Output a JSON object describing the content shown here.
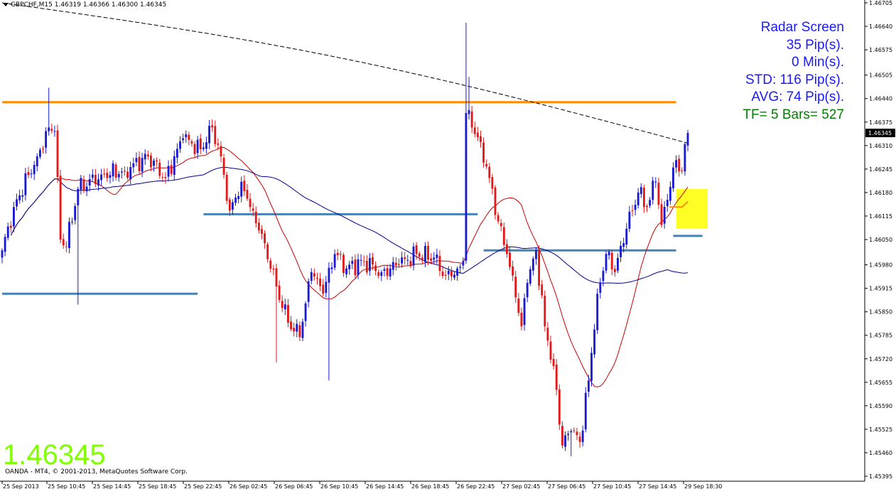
{
  "header": {
    "symbol_info": "GBPCHF,M15  1.46319 1.46366 1.46300 1.46345"
  },
  "radar": {
    "lines": [
      {
        "text": "Radar Screen",
        "color": "#1a1aff"
      },
      {
        "text": "35 Pip(s).",
        "color": "#1a1aff"
      },
      {
        "text": "0 Min(s).",
        "color": "#1a1aff"
      },
      {
        "text": "STD: 116 Pip(s).",
        "color": "#1a1aff"
      },
      {
        "text": "AVG: 74 Pip(s).",
        "color": "#1a1aff"
      },
      {
        "text": "TF= 5 Bars= 527",
        "color": "#008000"
      }
    ]
  },
  "big_price": "1.46345",
  "copyright": "OANDA - MT4, © 2001-2013, MetaQuotes Software Corp.",
  "colors": {
    "bull": "#1a1ad0",
    "bear": "#e01a1a",
    "level_orange": "#ff8c00",
    "level_blue": "#4682b4",
    "ma_fast": "#cc0000",
    "ma_slow": "#00008b",
    "ma_long": "#000000",
    "highlight": "#ffff00"
  },
  "chart_data": {
    "type": "candlestick",
    "symbol": "GBPCHF",
    "timeframe": "M15",
    "current_price": 1.46345,
    "ylim": [
      1.45395,
      1.46705
    ],
    "y_ticks": [
      "1.46705",
      "1.46640",
      "1.46575",
      "1.46505",
      "1.46440",
      "1.46375",
      "1.46310",
      "1.46245",
      "1.46180",
      "1.46115",
      "1.46050",
      "1.45980",
      "1.45915",
      "1.45850",
      "1.45785",
      "1.45720",
      "1.45655",
      "1.45590",
      "1.45525",
      "1.45460",
      "1.45395"
    ],
    "x_ticks": [
      "25 Sep 2013",
      "25 Sep 10:45",
      "25 Sep 14:45",
      "25 Sep 18:45",
      "25 Sep 22:45",
      "26 Sep 02:45",
      "26 Sep 06:45",
      "26 Sep 10:45",
      "26 Sep 14:45",
      "26 Sep 18:45",
      "26 Sep 22:45",
      "27 Sep 02:45",
      "27 Sep 06:45",
      "27 Sep 10:45",
      "27 Sep 14:45",
      "29 Sep 18:30"
    ],
    "anchors": [
      {
        "i": 0,
        "p": 1.4602
      },
      {
        "i": 4,
        "p": 1.4614
      },
      {
        "i": 12,
        "p": 1.4628
      },
      {
        "i": 16,
        "p": 1.4636
      },
      {
        "i": 18,
        "p": 1.4635
      },
      {
        "i": 20,
        "p": 1.4605
      },
      {
        "i": 22,
        "p": 1.4603
      },
      {
        "i": 26,
        "p": 1.4619
      },
      {
        "i": 34,
        "p": 1.4623
      },
      {
        "i": 42,
        "p": 1.4624
      },
      {
        "i": 50,
        "p": 1.4628
      },
      {
        "i": 56,
        "p": 1.4622
      },
      {
        "i": 62,
        "p": 1.4633
      },
      {
        "i": 68,
        "p": 1.463
      },
      {
        "i": 72,
        "p": 1.4636
      },
      {
        "i": 75,
        "p": 1.4628
      },
      {
        "i": 78,
        "p": 1.4613
      },
      {
        "i": 82,
        "p": 1.4621
      },
      {
        "i": 86,
        "p": 1.4613
      },
      {
        "i": 90,
        "p": 1.4604
      },
      {
        "i": 94,
        "p": 1.4592
      },
      {
        "i": 98,
        "p": 1.4582
      },
      {
        "i": 102,
        "p": 1.4578
      },
      {
        "i": 106,
        "p": 1.4596
      },
      {
        "i": 110,
        "p": 1.459
      },
      {
        "i": 114,
        "p": 1.4601
      },
      {
        "i": 118,
        "p": 1.4597
      },
      {
        "i": 124,
        "p": 1.4599
      },
      {
        "i": 130,
        "p": 1.4596
      },
      {
        "i": 136,
        "p": 1.4598
      },
      {
        "i": 142,
        "p": 1.4601
      },
      {
        "i": 148,
        "p": 1.46
      },
      {
        "i": 152,
        "p": 1.4595
      },
      {
        "i": 156,
        "p": 1.4597
      },
      {
        "i": 158,
        "p": 1.4599
      },
      {
        "i": 159,
        "p": 1.464
      },
      {
        "i": 161,
        "p": 1.4636
      },
      {
        "i": 164,
        "p": 1.4632
      },
      {
        "i": 167,
        "p": 1.4622
      },
      {
        "i": 170,
        "p": 1.461
      },
      {
        "i": 173,
        "p": 1.4601
      },
      {
        "i": 176,
        "p": 1.4589
      },
      {
        "i": 178,
        "p": 1.4581
      },
      {
        "i": 180,
        "p": 1.4593
      },
      {
        "i": 183,
        "p": 1.4602
      },
      {
        "i": 186,
        "p": 1.4581
      },
      {
        "i": 189,
        "p": 1.457
      },
      {
        "i": 192,
        "p": 1.4548
      },
      {
        "i": 195,
        "p": 1.4552
      },
      {
        "i": 198,
        "p": 1.4549
      },
      {
        "i": 201,
        "p": 1.4566
      },
      {
        "i": 204,
        "p": 1.459
      },
      {
        "i": 207,
        "p": 1.4601
      },
      {
        "i": 210,
        "p": 1.4596
      },
      {
        "i": 214,
        "p": 1.4608
      },
      {
        "i": 218,
        "p": 1.4618
      },
      {
        "i": 221,
        "p": 1.4614
      },
      {
        "i": 224,
        "p": 1.4621
      },
      {
        "i": 226,
        "p": 1.4609
      },
      {
        "i": 228,
        "p": 1.4616
      },
      {
        "i": 231,
        "p": 1.4627
      },
      {
        "i": 233,
        "p": 1.4624
      },
      {
        "i": 235,
        "p": 1.46345
      }
    ],
    "bar_count": 236,
    "levels": [
      {
        "name": "resistance",
        "price": 1.4643,
        "from_bar": 0,
        "to_bar": 231,
        "color": "orange"
      },
      {
        "name": "support-left",
        "price": 1.459,
        "from_bar": 0,
        "to_bar": 67,
        "color": "blue"
      },
      {
        "name": "mid-level",
        "price": 1.4612,
        "from_bar": 69,
        "to_bar": 163,
        "color": "blue"
      },
      {
        "name": "support-right",
        "price": 1.4602,
        "from_bar": 165,
        "to_bar": 231,
        "color": "blue"
      },
      {
        "name": "short-level",
        "price": 1.4606,
        "from_bar": 230,
        "to_bar": 240,
        "color": "blue"
      }
    ],
    "highlight_box": {
      "price_high": 1.4619,
      "price_low": 1.4608
    },
    "grid": false
  }
}
